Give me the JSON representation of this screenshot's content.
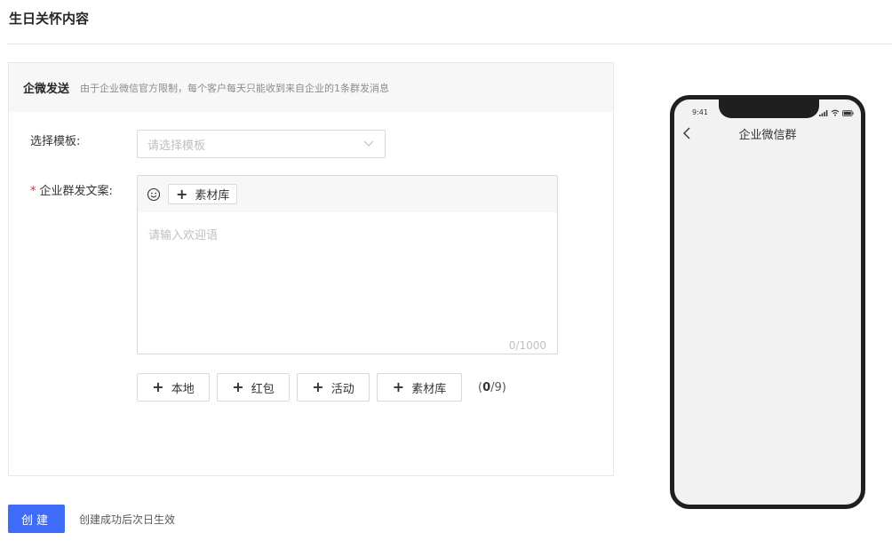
{
  "page": {
    "title": "生日关怀内容"
  },
  "panel": {
    "header_title": "企微发送",
    "header_note": "由于企业微信官方限制，每个客户每天只能收到来自企业的1条群发消息"
  },
  "form": {
    "template_label": "选择模板:",
    "template_placeholder": "请选择模板",
    "content_required": "*",
    "content_label": "企业群发文案:",
    "toolbar_material_label": "素材库",
    "content_placeholder": "请输入欢迎语",
    "char_count": "0/1000"
  },
  "attachments": {
    "buttons": [
      {
        "label": "本地"
      },
      {
        "label": "红包"
      },
      {
        "label": "活动"
      },
      {
        "label": "素材库"
      }
    ],
    "count_open": "(",
    "count_current": "0",
    "count_rest": "/9)"
  },
  "footer": {
    "create_label": "创建",
    "create_note": "创建成功后次日生效"
  },
  "phone": {
    "time": "9:41",
    "title": "企业微信群"
  },
  "colors": {
    "primary": "#3e6cf6",
    "required": "#f5222d"
  }
}
